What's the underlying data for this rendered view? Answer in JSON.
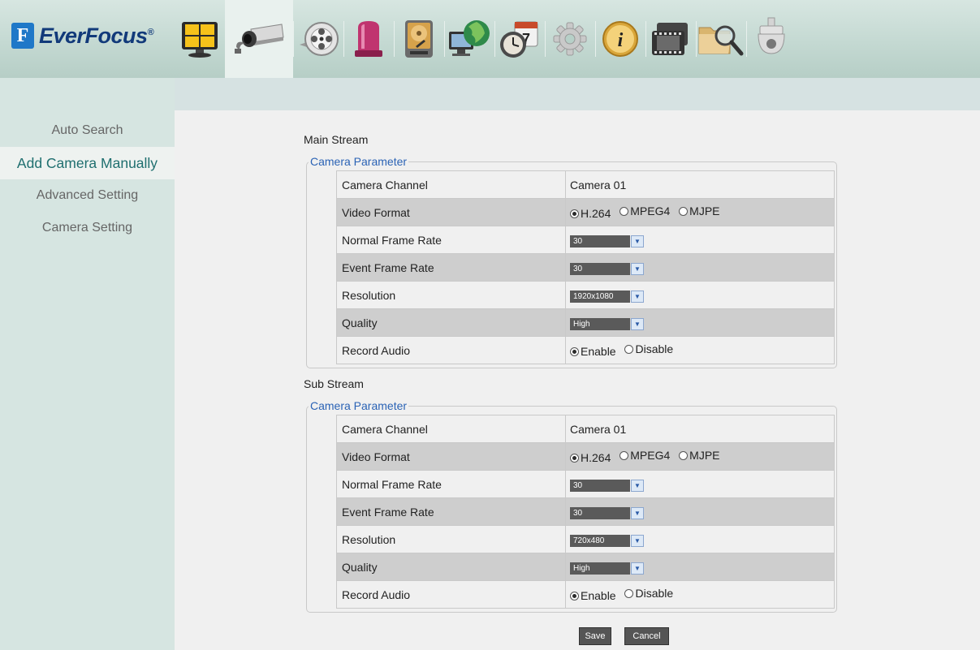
{
  "brand": {
    "mark": "F",
    "name": "EverFocus",
    "reg": "®"
  },
  "toolbar": [
    {
      "icon": "monitor-icon",
      "name": "Monitor"
    },
    {
      "icon": "camera-icon",
      "name": "Camera",
      "active": true
    },
    {
      "icon": "record-reel-icon",
      "name": "Record"
    },
    {
      "icon": "alarm-icon",
      "name": "Alarm"
    },
    {
      "icon": "hard-disk-icon",
      "name": "Disk"
    },
    {
      "icon": "network-icon",
      "name": "Network"
    },
    {
      "icon": "schedule-icon",
      "name": "Schedule",
      "text": "7"
    },
    {
      "icon": "gear-icon",
      "name": "System"
    },
    {
      "icon": "info-icon",
      "name": "Information",
      "text": "i"
    },
    {
      "icon": "backup-icon",
      "name": "Backup"
    },
    {
      "icon": "search-folder-icon",
      "name": "Search"
    },
    {
      "icon": "ptz-dome-icon",
      "name": "PTZ"
    }
  ],
  "sidebar": {
    "items": [
      {
        "label": "Auto Search"
      },
      {
        "label": "Add Camera Manually",
        "active": true
      },
      {
        "label": "Advanced Setting"
      },
      {
        "label": "Camera Setting"
      }
    ]
  },
  "main_stream": {
    "title": "Main Stream",
    "legend": "Camera Parameter",
    "camera_channel": {
      "label": "Camera Channel",
      "value": "Camera 01"
    },
    "video_format": {
      "label": "Video Format",
      "options": [
        "H.264",
        "MPEG4",
        "MJPE"
      ],
      "selected": "H.264"
    },
    "normal_frame_rate": {
      "label": "Normal Frame Rate",
      "value": "30"
    },
    "event_frame_rate": {
      "label": "Event Frame Rate",
      "value": "30"
    },
    "resolution": {
      "label": "Resolution",
      "value": "1920x1080"
    },
    "quality": {
      "label": "Quality",
      "value": "High"
    },
    "record_audio": {
      "label": "Record Audio",
      "options": [
        "Enable",
        "Disable"
      ],
      "selected": "Enable"
    }
  },
  "sub_stream": {
    "title": "Sub Stream",
    "legend": "Camera Parameter",
    "camera_channel": {
      "label": "Camera Channel",
      "value": "Camera 01"
    },
    "video_format": {
      "label": "Video Format",
      "options": [
        "H.264",
        "MPEG4",
        "MJPE"
      ],
      "selected": "H.264"
    },
    "normal_frame_rate": {
      "label": "Normal Frame Rate",
      "value": "30"
    },
    "event_frame_rate": {
      "label": "Event Frame Rate",
      "value": "30"
    },
    "resolution": {
      "label": "Resolution",
      "value": "720x480"
    },
    "quality": {
      "label": "Quality",
      "value": "High"
    },
    "record_audio": {
      "label": "Record Audio",
      "options": [
        "Enable",
        "Disable"
      ],
      "selected": "Enable"
    }
  },
  "actions": {
    "save": "Save",
    "cancel": "Cancel"
  }
}
